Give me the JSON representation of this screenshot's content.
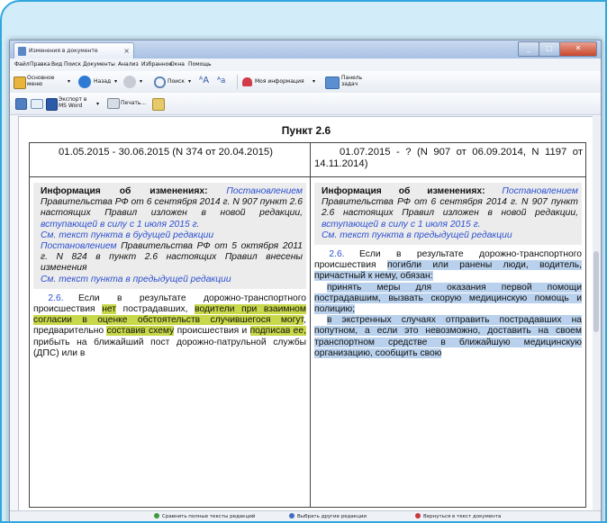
{
  "window": {
    "tab_title": "Изменения в документе",
    "tab_close": "×"
  },
  "menu": [
    "Файл",
    "Правка",
    "Вид",
    "Поиск",
    "Документы",
    "Анализ",
    "Избранное",
    "Окна",
    "Помощь"
  ],
  "toolbar1": {
    "main_menu_label": "Основное меню",
    "back_label": "Назад",
    "search_label": "Поиск",
    "my_info_label": "Моя информация",
    "tasks_label": "Панель задач"
  },
  "toolbar2": {
    "export_label": "Экспорт в MS Word",
    "print_label": "Печать..."
  },
  "document": {
    "title": "Пункт 2.6",
    "left_header": "01.05.2015 - 30.06.2015 (N 374 от 20.04.2015)",
    "right_header": "01.07.2015 - ? (N 907 от 06.09.2014, N 1197 от 14.11.2014)",
    "info_label": "Информация об изменениях:",
    "left_info_link1": "Постановлением",
    "left_info_text1": "Правительства РФ от 6 сентября 2014 г. N 907 пункт 2.6 настоящих Правил изложен в новой редакции,",
    "left_info_link2": "вступающей в силу с 1 июля 2015 г.",
    "left_info_link3": "См. текст пункта в будущей редакции",
    "left_info_link4": "Постановлением",
    "left_info_text2": "Правительства РФ от 5 октября 2011 г. N 824 в пункт 2.6 настоящих Правил внесены изменения",
    "left_info_link5": "См. текст пункта в предыдущей редакции",
    "left_para_num": "2.6.",
    "left_t1": "Если в результате дорожно-транспортного происшествия",
    "left_h1": "нет",
    "left_t2": "пострадавших,",
    "left_h2": "водители при взаимном согласии в оценке обстоятельств случившегося могут",
    "left_t3": ", предварительно",
    "left_h3": "составив схему",
    "left_t4": "происшествия и",
    "left_h4": "подписав ее,",
    "left_t5": "прибыть на ближайший пост дорожно-патрульной службы (ДПС) или в",
    "right_info_link1": "Постановлением",
    "right_info_text1": "Правительства РФ от 6 сентября 2014 г. N 907 пункт 2.6 настоящих Правил изложен в новой редакции,",
    "right_info_link2": "вступающей в силу с 1 июля 2015 г.",
    "right_info_link3": "См. текст пункта в предыдущей редакции",
    "right_para_num": "2.6.",
    "right_t1": "Если в результате дорожно-транспортного происшествия",
    "right_h1": "погибли или ранены люди, водитель, причастный к нему, обязан:",
    "right_h2": "принять меры для оказания первой помощи пострадавшим, вызвать скорую медицинскую помощь и полицию;",
    "right_h3": "в экстренных случаях отправить пострадавших на попутном, а если это невозможно, доставить на своем транспортном средстве в ближайшую медицинскую организацию, сообщить свою"
  },
  "status": {
    "compare_full": "Сравнить полные тексты редакций",
    "choose_other": "Выбрать другие редакции",
    "back_to_doc": "Вернуться в текст документа"
  },
  "colors": {
    "frame_border": "#2fa7de",
    "frame_bg": "#d2ecf9",
    "highlight_added": "#c8d84a",
    "highlight_new": "#b9d1ec",
    "link": "#2b4fd0"
  }
}
